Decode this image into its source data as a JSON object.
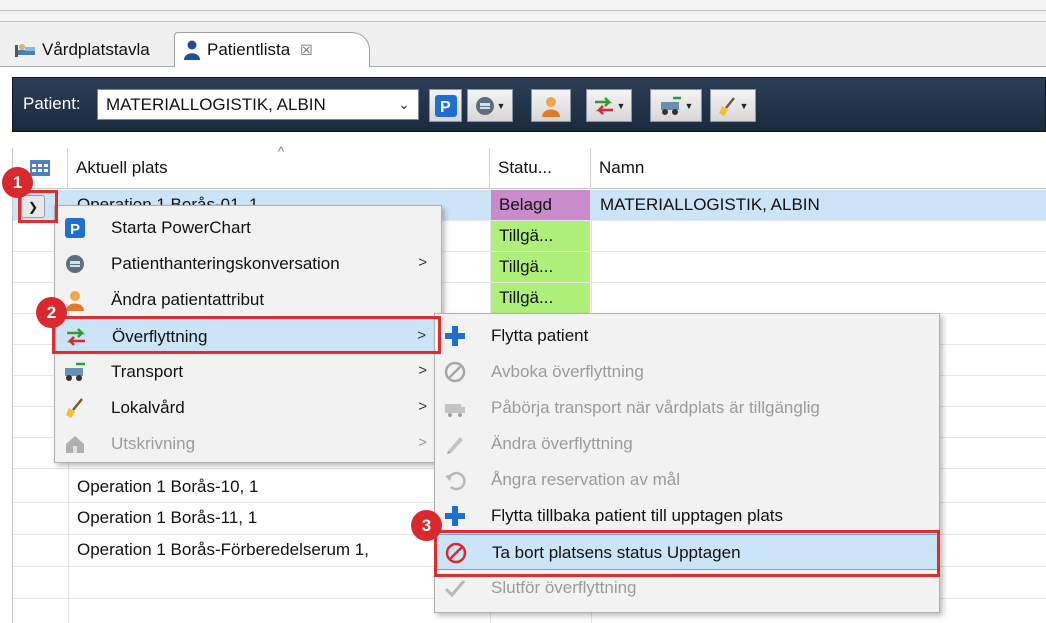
{
  "tabs": [
    {
      "label": "Vårdplatstavla",
      "icon": "bed-icon"
    },
    {
      "label": "Patientlista",
      "icon": "person-icon",
      "close": "☒"
    }
  ],
  "toolbar": {
    "patient_label": "Patient:",
    "patient_value": "MATERIALLOGISTIK, ALBIN",
    "buttons": [
      "powerchart-icon",
      "conversation-icon",
      "patient-attributes-icon",
      "transfer-icon",
      "transport-icon",
      "cleaning-icon"
    ]
  },
  "grid": {
    "columns": [
      "Aktuell plats",
      "Statu...",
      "Namn"
    ],
    "rows": [
      {
        "plats": "Operation 1 Borås-01, 1",
        "status": "Belagd",
        "namn": "MATERIALLOGISTIK, ALBIN"
      },
      {
        "plats": "",
        "status": "Tillgä...",
        "namn": ""
      },
      {
        "plats": "",
        "status": "Tillgä...",
        "namn": ""
      },
      {
        "plats": "",
        "status": "Tillgä...",
        "namn": ""
      },
      {
        "plats": "Operation 1 Borås-10, 1",
        "status": "",
        "namn": ""
      },
      {
        "plats": "Operation 1 Borås-11, 1",
        "status": "",
        "namn": ""
      },
      {
        "plats": "Operation 1 Borås-Förberedelserum 1,",
        "status": "",
        "namn": ""
      }
    ]
  },
  "context_menu": {
    "items": [
      {
        "label": "Starta PowerChart",
        "icon": "powerchart-icon",
        "submenu": false,
        "disabled": false
      },
      {
        "label": "Patienthanteringskonversation",
        "icon": "conversation-icon",
        "submenu": true,
        "disabled": false
      },
      {
        "label": "Ändra patientattribut",
        "icon": "patient-attributes-icon",
        "submenu": false,
        "disabled": false
      },
      {
        "label": "Överflyttning",
        "icon": "transfer-icon",
        "submenu": true,
        "disabled": false,
        "highlighted": true
      },
      {
        "label": "Transport",
        "icon": "transport-icon",
        "submenu": true,
        "disabled": false
      },
      {
        "label": "Lokalvård",
        "icon": "cleaning-icon",
        "submenu": true,
        "disabled": false
      },
      {
        "label": "Utskrivning",
        "icon": "discharge-icon",
        "submenu": true,
        "disabled": true
      }
    ],
    "arrow": ">"
  },
  "submenu": {
    "items": [
      {
        "label": "Flytta patient",
        "icon": "plus-icon",
        "disabled": false
      },
      {
        "label": "Avboka överflyttning",
        "icon": "prohibited-icon",
        "disabled": true
      },
      {
        "label": "Påbörja transport när vårdplats är tillgänglig",
        "icon": "ambulance-icon",
        "disabled": true
      },
      {
        "label": "Ändra överflyttning",
        "icon": "pencil-icon",
        "disabled": true
      },
      {
        "label": "Ångra reservation av mål",
        "icon": "undo-icon",
        "disabled": true
      },
      {
        "label": "Flytta tillbaka patient till upptagen plats",
        "icon": "plus-icon",
        "disabled": false
      },
      {
        "label": "Ta bort platsens status Upptagen",
        "icon": "prohibited-icon",
        "disabled": false,
        "highlighted": true
      },
      {
        "label": "Slutför överflyttning",
        "icon": "checkmark-icon",
        "disabled": true
      }
    ]
  },
  "callouts": [
    "1",
    "2",
    "3"
  ],
  "colors": {
    "status_belagd": "#c98bc9",
    "status_tillganglig": "#aef07a",
    "selected_row": "#cce4f7",
    "callout": "#d9292c"
  }
}
